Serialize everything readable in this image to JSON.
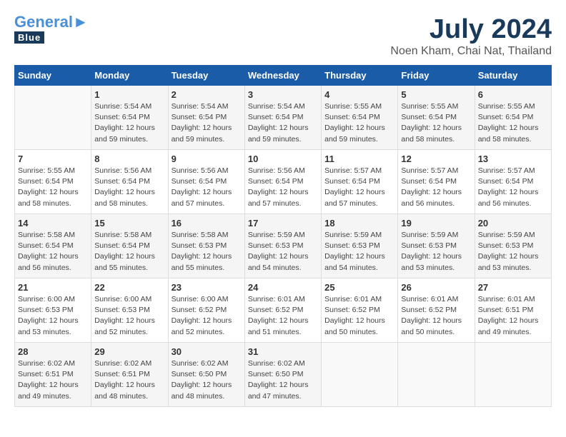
{
  "header": {
    "logo_general": "General",
    "logo_blue": "Blue",
    "title": "July 2024",
    "subtitle": "Noen Kham, Chai Nat, Thailand"
  },
  "calendar": {
    "days_of_week": [
      "Sunday",
      "Monday",
      "Tuesday",
      "Wednesday",
      "Thursday",
      "Friday",
      "Saturday"
    ],
    "weeks": [
      [
        {
          "day": "",
          "info": ""
        },
        {
          "day": "1",
          "info": "Sunrise: 5:54 AM\nSunset: 6:54 PM\nDaylight: 12 hours\nand 59 minutes."
        },
        {
          "day": "2",
          "info": "Sunrise: 5:54 AM\nSunset: 6:54 PM\nDaylight: 12 hours\nand 59 minutes."
        },
        {
          "day": "3",
          "info": "Sunrise: 5:54 AM\nSunset: 6:54 PM\nDaylight: 12 hours\nand 59 minutes."
        },
        {
          "day": "4",
          "info": "Sunrise: 5:55 AM\nSunset: 6:54 PM\nDaylight: 12 hours\nand 59 minutes."
        },
        {
          "day": "5",
          "info": "Sunrise: 5:55 AM\nSunset: 6:54 PM\nDaylight: 12 hours\nand 58 minutes."
        },
        {
          "day": "6",
          "info": "Sunrise: 5:55 AM\nSunset: 6:54 PM\nDaylight: 12 hours\nand 58 minutes."
        }
      ],
      [
        {
          "day": "7",
          "info": "Sunrise: 5:55 AM\nSunset: 6:54 PM\nDaylight: 12 hours\nand 58 minutes."
        },
        {
          "day": "8",
          "info": "Sunrise: 5:56 AM\nSunset: 6:54 PM\nDaylight: 12 hours\nand 58 minutes."
        },
        {
          "day": "9",
          "info": "Sunrise: 5:56 AM\nSunset: 6:54 PM\nDaylight: 12 hours\nand 57 minutes."
        },
        {
          "day": "10",
          "info": "Sunrise: 5:56 AM\nSunset: 6:54 PM\nDaylight: 12 hours\nand 57 minutes."
        },
        {
          "day": "11",
          "info": "Sunrise: 5:57 AM\nSunset: 6:54 PM\nDaylight: 12 hours\nand 57 minutes."
        },
        {
          "day": "12",
          "info": "Sunrise: 5:57 AM\nSunset: 6:54 PM\nDaylight: 12 hours\nand 56 minutes."
        },
        {
          "day": "13",
          "info": "Sunrise: 5:57 AM\nSunset: 6:54 PM\nDaylight: 12 hours\nand 56 minutes."
        }
      ],
      [
        {
          "day": "14",
          "info": "Sunrise: 5:58 AM\nSunset: 6:54 PM\nDaylight: 12 hours\nand 56 minutes."
        },
        {
          "day": "15",
          "info": "Sunrise: 5:58 AM\nSunset: 6:54 PM\nDaylight: 12 hours\nand 55 minutes."
        },
        {
          "day": "16",
          "info": "Sunrise: 5:58 AM\nSunset: 6:53 PM\nDaylight: 12 hours\nand 55 minutes."
        },
        {
          "day": "17",
          "info": "Sunrise: 5:59 AM\nSunset: 6:53 PM\nDaylight: 12 hours\nand 54 minutes."
        },
        {
          "day": "18",
          "info": "Sunrise: 5:59 AM\nSunset: 6:53 PM\nDaylight: 12 hours\nand 54 minutes."
        },
        {
          "day": "19",
          "info": "Sunrise: 5:59 AM\nSunset: 6:53 PM\nDaylight: 12 hours\nand 53 minutes."
        },
        {
          "day": "20",
          "info": "Sunrise: 5:59 AM\nSunset: 6:53 PM\nDaylight: 12 hours\nand 53 minutes."
        }
      ],
      [
        {
          "day": "21",
          "info": "Sunrise: 6:00 AM\nSunset: 6:53 PM\nDaylight: 12 hours\nand 53 minutes."
        },
        {
          "day": "22",
          "info": "Sunrise: 6:00 AM\nSunset: 6:53 PM\nDaylight: 12 hours\nand 52 minutes."
        },
        {
          "day": "23",
          "info": "Sunrise: 6:00 AM\nSunset: 6:52 PM\nDaylight: 12 hours\nand 52 minutes."
        },
        {
          "day": "24",
          "info": "Sunrise: 6:01 AM\nSunset: 6:52 PM\nDaylight: 12 hours\nand 51 minutes."
        },
        {
          "day": "25",
          "info": "Sunrise: 6:01 AM\nSunset: 6:52 PM\nDaylight: 12 hours\nand 50 minutes."
        },
        {
          "day": "26",
          "info": "Sunrise: 6:01 AM\nSunset: 6:52 PM\nDaylight: 12 hours\nand 50 minutes."
        },
        {
          "day": "27",
          "info": "Sunrise: 6:01 AM\nSunset: 6:51 PM\nDaylight: 12 hours\nand 49 minutes."
        }
      ],
      [
        {
          "day": "28",
          "info": "Sunrise: 6:02 AM\nSunset: 6:51 PM\nDaylight: 12 hours\nand 49 minutes."
        },
        {
          "day": "29",
          "info": "Sunrise: 6:02 AM\nSunset: 6:51 PM\nDaylight: 12 hours\nand 48 minutes."
        },
        {
          "day": "30",
          "info": "Sunrise: 6:02 AM\nSunset: 6:50 PM\nDaylight: 12 hours\nand 48 minutes."
        },
        {
          "day": "31",
          "info": "Sunrise: 6:02 AM\nSunset: 6:50 PM\nDaylight: 12 hours\nand 47 minutes."
        },
        {
          "day": "",
          "info": ""
        },
        {
          "day": "",
          "info": ""
        },
        {
          "day": "",
          "info": ""
        }
      ]
    ]
  }
}
